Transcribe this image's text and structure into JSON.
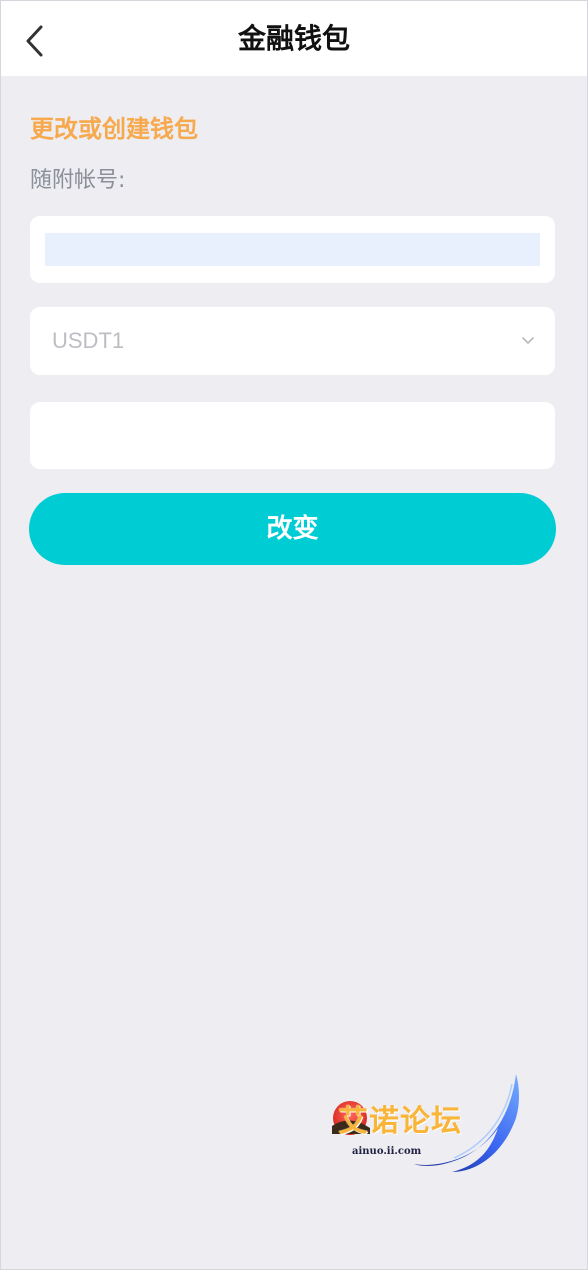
{
  "header": {
    "back_icon": "chevron-left-icon",
    "title": "金融钱包"
  },
  "form": {
    "section_title": "更改或创建钱包",
    "account_label": "随附帐号:",
    "account_value": "",
    "currency": {
      "selected": "USDT1",
      "icon": "chevron-down-icon"
    },
    "address_value": "",
    "submit_label": "改变"
  },
  "watermark": {
    "text": "艾诺论坛",
    "domain": "ainuo.ii.com"
  },
  "colors": {
    "accent": "#00ccd4",
    "section_title": "#f7a94d",
    "background": "#ededf2",
    "autofill": "#e8f0fe"
  }
}
